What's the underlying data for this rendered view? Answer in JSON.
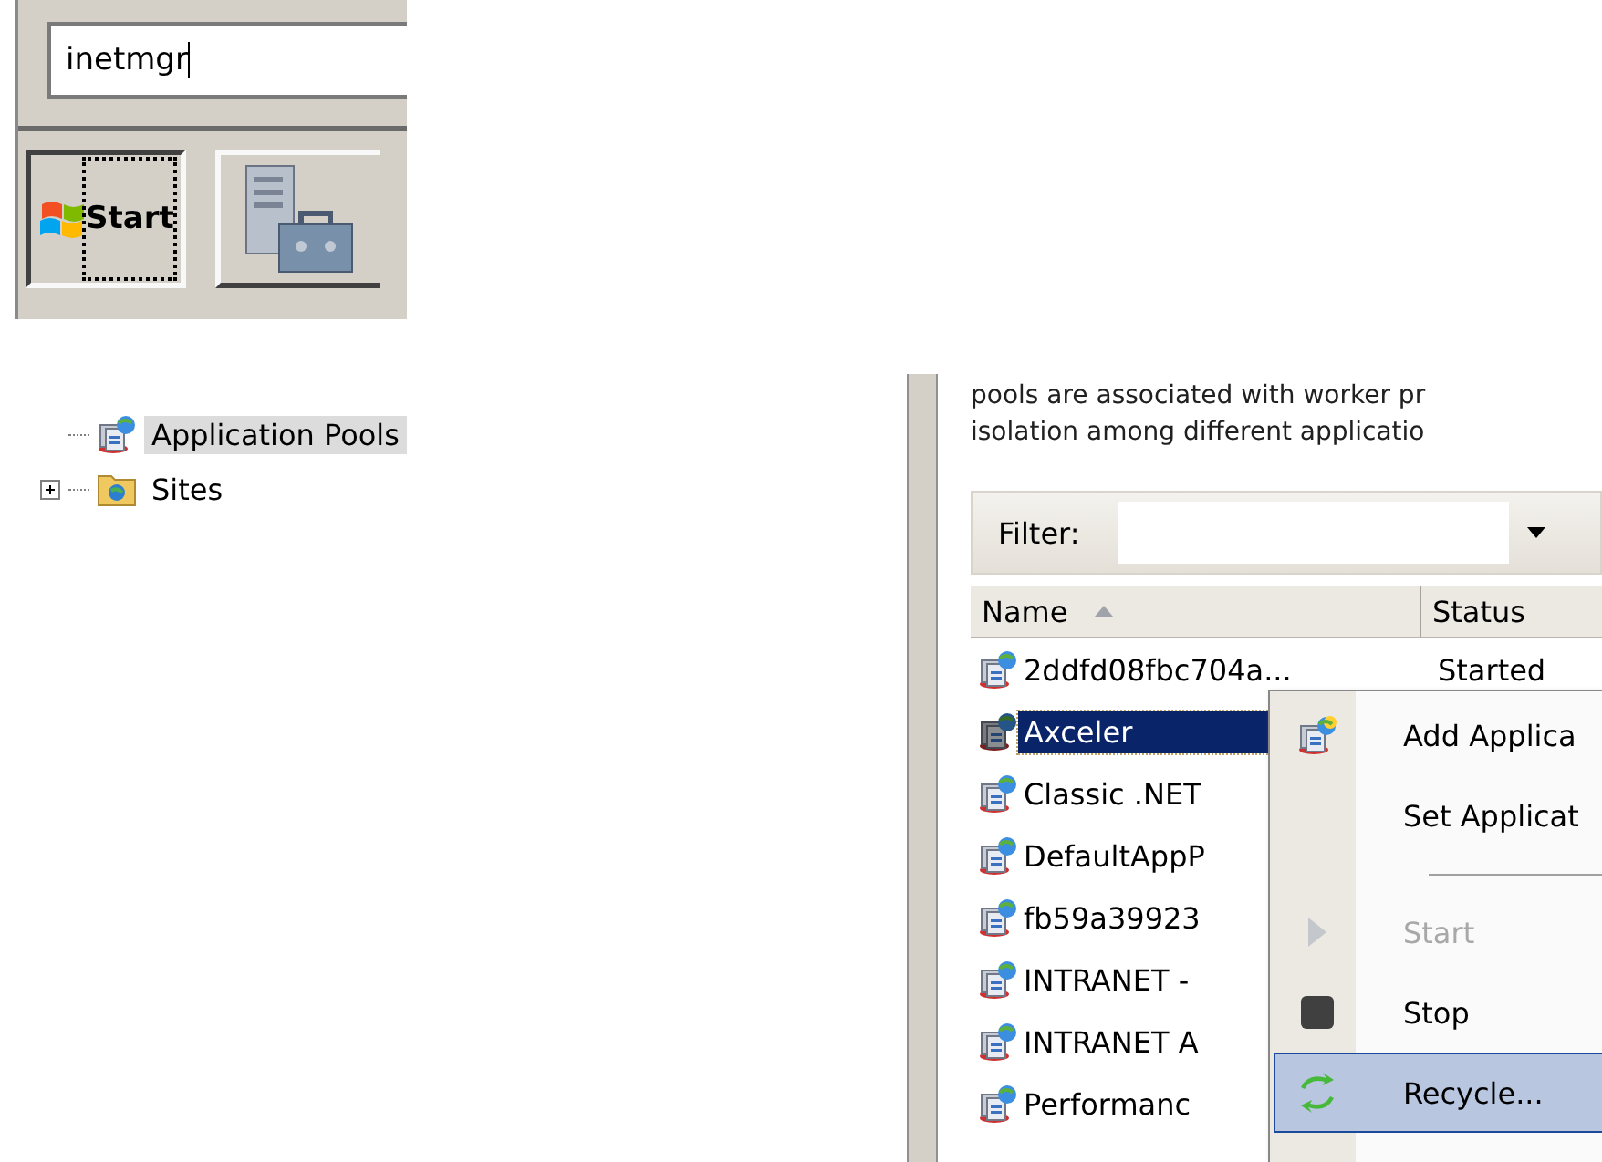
{
  "run_box": {
    "value": "inetmgr"
  },
  "taskbar": {
    "start_label": "Start",
    "buttons": [
      {
        "kind": "start",
        "focused": true
      },
      {
        "kind": "server-tools",
        "focused": false
      }
    ]
  },
  "tree": {
    "items": [
      {
        "label": "Application Pools",
        "kind": "pools",
        "selected": true
      },
      {
        "label": "Sites",
        "kind": "sites",
        "selected": false,
        "expanded": false
      }
    ]
  },
  "description": [
    "pools are associated with worker pr",
    "isolation among different applicatio"
  ],
  "filter": {
    "label": "Filter:"
  },
  "table": {
    "columns": [
      {
        "label": "Name",
        "sorted": true
      },
      {
        "label": "Status",
        "sorted": false
      }
    ],
    "rows": [
      {
        "name": "2ddfd08fbc704a...",
        "status": "Started",
        "selected": false
      },
      {
        "name": "Axceler",
        "selected": true
      },
      {
        "name": "Classic .NET",
        "selected": false
      },
      {
        "name": "DefaultAppP",
        "selected": false
      },
      {
        "name": "fb59a39923",
        "selected": false
      },
      {
        "name": "INTRANET -",
        "selected": false
      },
      {
        "name": "INTRANET A",
        "selected": false
      },
      {
        "name": "Performanc",
        "selected": false
      }
    ]
  },
  "context_menu": {
    "items": [
      {
        "kind": "add",
        "label": "Add Applica",
        "disabled": false,
        "selected": false
      },
      {
        "kind": "plain",
        "label": "Set Applicat",
        "disabled": false,
        "selected": false
      },
      {
        "kind": "separator"
      },
      {
        "kind": "start",
        "label": "Start",
        "disabled": true,
        "selected": false
      },
      {
        "kind": "stop",
        "label": "Stop",
        "disabled": false,
        "selected": false
      },
      {
        "kind": "recycle",
        "label": "Recycle...",
        "disabled": false,
        "selected": true
      }
    ]
  }
}
